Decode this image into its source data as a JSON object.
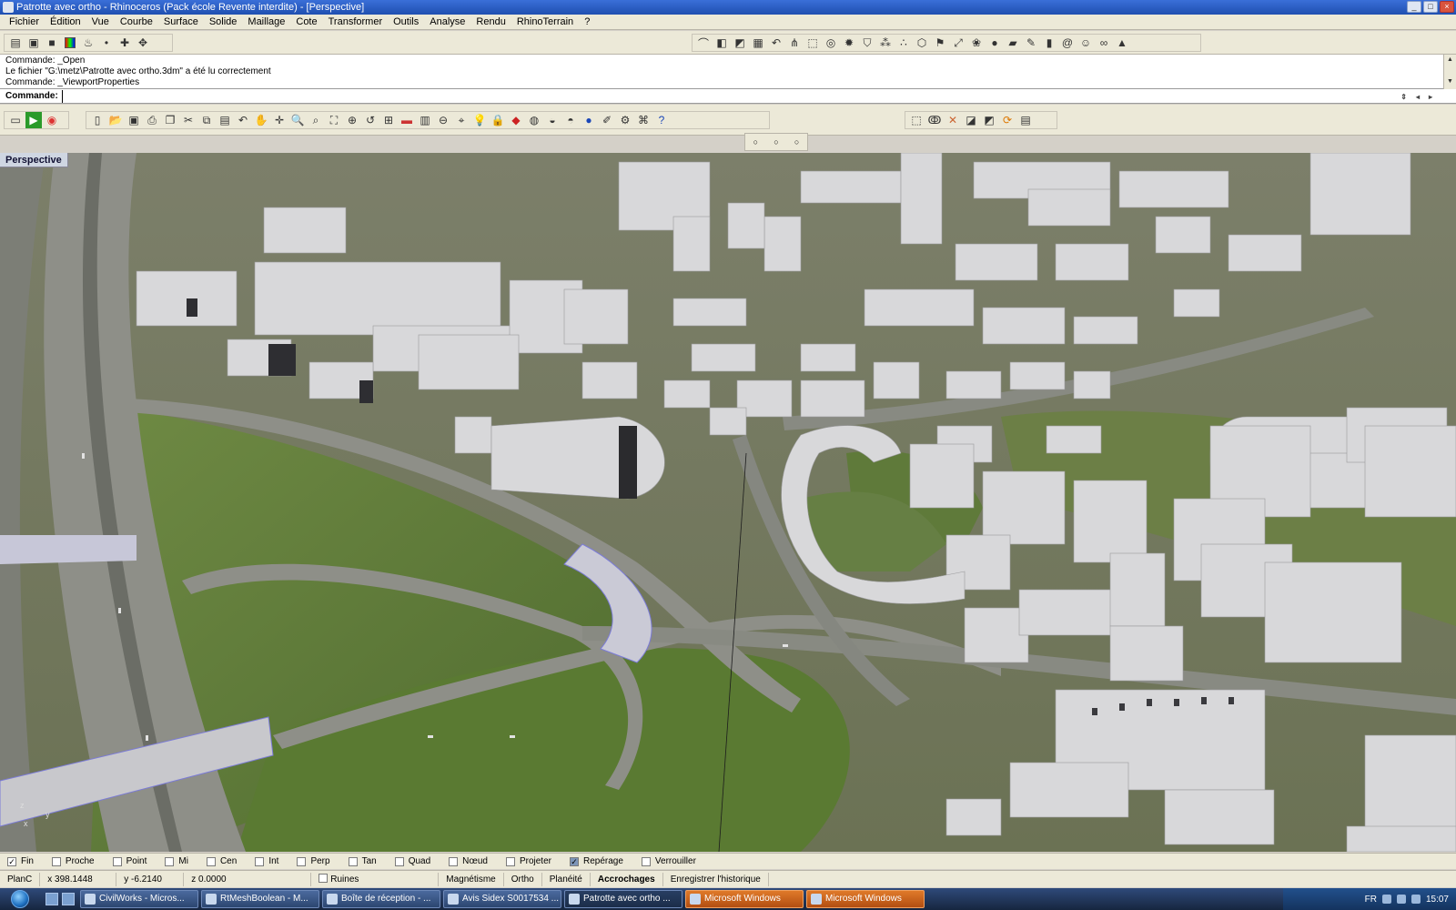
{
  "window": {
    "title": "Patrotte avec ortho - Rhinoceros (Pack école Revente interdite) - [Perspective]"
  },
  "menu": [
    "Fichier",
    "Édition",
    "Vue",
    "Courbe",
    "Surface",
    "Solide",
    "Maillage",
    "Cote",
    "Transformer",
    "Outils",
    "Analyse",
    "Rendu",
    "RhinoTerrain",
    "?"
  ],
  "command_history": [
    "Commande: _Open",
    "Le fichier \"G:\\metz\\Patrotte avec ortho.3dm\" a été lu correctement",
    "Commande: _ViewportProperties"
  ],
  "command_prompt": {
    "label": "Commande:",
    "value": ""
  },
  "viewport": {
    "title": "Perspective",
    "axis_x": "x",
    "axis_y": "y",
    "axis_z": "z"
  },
  "osnaps": [
    {
      "label": "Fin",
      "checked": true
    },
    {
      "label": "Proche",
      "checked": false
    },
    {
      "label": "Point",
      "checked": false
    },
    {
      "label": "Mi",
      "checked": false
    },
    {
      "label": "Cen",
      "checked": false
    },
    {
      "label": "Int",
      "checked": false
    },
    {
      "label": "Perp",
      "checked": false
    },
    {
      "label": "Tan",
      "checked": false
    },
    {
      "label": "Quad",
      "checked": false
    },
    {
      "label": "Nœud",
      "checked": false
    },
    {
      "label": "Projeter",
      "checked": false
    },
    {
      "label": "Repérage",
      "checked": true
    },
    {
      "label": "Verrouiller",
      "checked": false
    }
  ],
  "status": {
    "cplane": "PlanC",
    "x": "x 398.1448",
    "y": "y -6.2140",
    "z": "z 0.0000",
    "layer": "Ruines",
    "magnetisme": "Magnétisme",
    "ortho": "Ortho",
    "planeite": "Planéité",
    "accrochages": "Accrochages",
    "historique": "Enregistrer l'historique"
  },
  "taskbar": {
    "items": [
      {
        "label": "CivilWorks - Micros...",
        "style": "normal"
      },
      {
        "label": "RtMeshBoolean - M...",
        "style": "normal"
      },
      {
        "label": "Boîte de réception - ...",
        "style": "normal"
      },
      {
        "label": "Avis Sidex S0017534 ...",
        "style": "normal"
      },
      {
        "label": "Patrotte avec ortho ...",
        "style": "active"
      },
      {
        "label": "Microsoft Windows",
        "style": "orange"
      },
      {
        "label": "Microsoft Windows",
        "style": "orange"
      }
    ],
    "lang": "FR",
    "clock": "15:07"
  },
  "colors": {
    "titlebar": "#1f4fb0",
    "chrome": "#ece9d8",
    "viewport_label": "#cfd6e2",
    "grass": "#5f7a3a",
    "road": "#8e8f88",
    "building": "#d8d8da"
  }
}
